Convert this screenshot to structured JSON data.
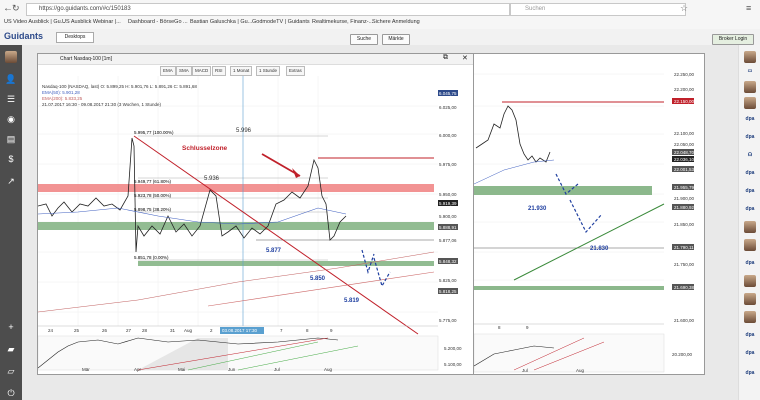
{
  "browser": {
    "url": "https://go.guidants.com/#c/150183",
    "search_placeholder": "Suchen",
    "bookmarks": [
      "US Video Ausblick | Gu...",
      "US Ausblick Webinar |...",
      "Dashboard - BörseGo ...",
      "Bastian Galuschka | Gu...",
      "GodmodeTV | Guidants",
      "Realtimekurse, Finanz-...",
      "Sichere Anmeldung"
    ]
  },
  "app": {
    "logo": "Guidants",
    "desktop_button": "Desktops",
    "search_button": "Suche",
    "markets_button": "Märkte",
    "broker_button": "Broker Login"
  },
  "chart": {
    "window_title": "Chart Nasdaq-100 [1m]",
    "toolbar": [
      "EMA",
      "SMA",
      "MACD",
      "RSI",
      "1 Monat",
      "1 Stunde",
      "Extras"
    ],
    "info_line1": "Nasdaq-100 (NASDAQ, last) O: 5.899,25  H: 5.901,76  L: 5.891,26  C: 5.891,68",
    "info_line2": "EMA(50): 5.901,28",
    "info_line3": "EMA(200): 5.833,25",
    "info_line4": "21.07.2017 16:30 - 09.08.2017 21:30  (3 Wochen, 1 Stunde)",
    "fib_labels": [
      "5.995,77 (100.00%)",
      "5.949,77 (61.80%)",
      "5.923,78 (50.00%)",
      "5.898,75 (38.20%)",
      "5.851,78 (0.00%)"
    ],
    "annotations": [
      "Schlusselzone",
      "5.996",
      "5.936",
      "5.877",
      "5.850",
      "5.819"
    ],
    "price_ticks": [
      "6.045,75",
      "6.025,00",
      "6.000,00",
      "5.975,00",
      "5.950,00",
      "5.919,39",
      "5.900,00",
      "5.888,91",
      "5.877,06",
      "5.848,32",
      "5.825,00",
      "5.818,25",
      "5.775,00"
    ],
    "time_ticks": [
      "24",
      "25",
      "26",
      "27",
      "28",
      "31",
      "Aug",
      "2",
      "03.08.2017 17:30",
      "7",
      "8",
      "9"
    ],
    "lower_ticks": [
      "Mär",
      "Apr",
      "Mai",
      "Jun",
      "Jul",
      "Aug"
    ],
    "lower_prices": [
      "5.200,00",
      "5.100,00"
    ],
    "colors": {
      "resistance_zone": "#f08080",
      "support_zone": "#7fb07f",
      "trend_red": "#c0202a",
      "blue_arrow": "#1f3fa0"
    }
  },
  "chart2": {
    "price_ticks": [
      "22.250,00",
      "22.200,00",
      "22.150,00",
      "22.100,00",
      "22.050,00",
      "22.048,70",
      "22.036,10",
      "22.001,53",
      "21.955,79",
      "21.900,00",
      "21.880,92",
      "21.850,00",
      "21.790,11",
      "21.750,00",
      "21.690,38",
      "21.600,00"
    ],
    "annotations": [
      "21.930",
      "21.830"
    ],
    "time_ticks": [
      "8",
      "9"
    ],
    "lower_ticks": [
      "Jul",
      "Aug"
    ],
    "lower_price": "20.200,00"
  }
}
